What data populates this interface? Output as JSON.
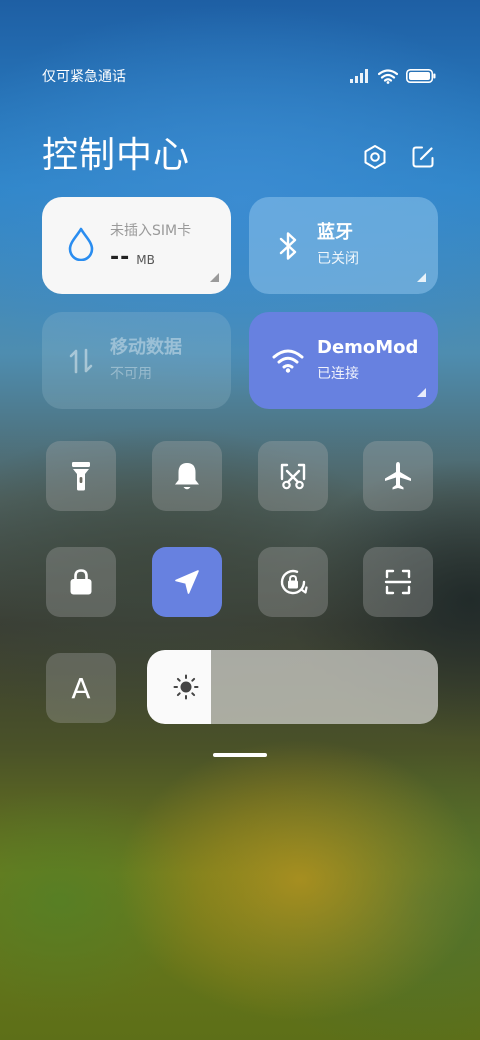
{
  "status_bar": {
    "carrier": "仅可紧急通话",
    "icons": [
      "signal-icon",
      "wifi-icon",
      "battery-icon"
    ]
  },
  "header": {
    "title": "控制中心",
    "actions": [
      "settings-icon",
      "edit-icon"
    ]
  },
  "cards": {
    "data_usage": {
      "label": "未插入SIM卡",
      "value": "--",
      "unit": "MB",
      "icon": "water-drop-icon",
      "active": true
    },
    "bluetooth": {
      "title": "蓝牙",
      "subtitle": "已关闭",
      "icon": "bluetooth-icon",
      "active": false
    },
    "mobile_data": {
      "title": "移动数据",
      "subtitle": "不可用",
      "icon": "data-arrows-icon",
      "enabled": false
    },
    "wifi": {
      "title": "DemoMod",
      "subtitle": "已连接",
      "icon": "wifi-icon",
      "active": true
    }
  },
  "toggles_row1": [
    {
      "name": "flashlight",
      "icon": "flashlight-icon",
      "active": false
    },
    {
      "name": "ring",
      "icon": "bell-icon",
      "active": false
    },
    {
      "name": "screenshot",
      "icon": "scissors-icon",
      "active": false
    },
    {
      "name": "airplane",
      "icon": "airplane-icon",
      "active": false
    }
  ],
  "toggles_row2": [
    {
      "name": "lock-screen",
      "icon": "lock-icon",
      "active": false
    },
    {
      "name": "location",
      "icon": "location-arrow-icon",
      "active": true
    },
    {
      "name": "auto-rotate",
      "icon": "rotation-lock-icon",
      "active": false
    },
    {
      "name": "scan",
      "icon": "scan-icon",
      "active": false
    }
  ],
  "auto_brightness": {
    "icon": "font-a-icon",
    "label": "A"
  },
  "brightness": {
    "level": 0.22,
    "icon": "sun-icon"
  },
  "colors": {
    "accent": "#6781e0",
    "tile_bg": "rgba(175,175,175,0.32)",
    "card_white": "#f7f7f7",
    "drop_blue": "#2a8df0"
  }
}
